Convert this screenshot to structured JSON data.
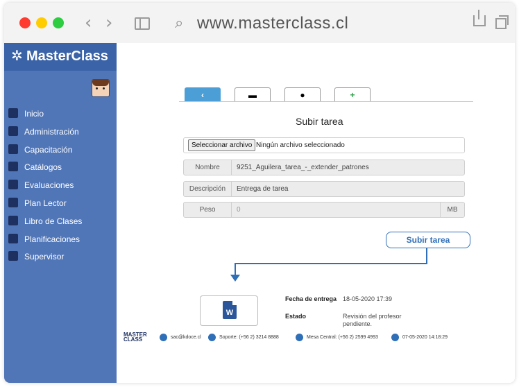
{
  "browser": {
    "url": "www.masterclass.cl",
    "dots": [
      "#ff3b30",
      "#ffcc00",
      "#2ecc40"
    ],
    "back": "‹",
    "forward": "›"
  },
  "brand": {
    "name": "MasterClass",
    "star": "✲"
  },
  "sidebar": {
    "items": [
      {
        "label": "Inicio",
        "icon": "home-icon"
      },
      {
        "label": "Administración",
        "icon": "admin-icon"
      },
      {
        "label": "Capacitación",
        "icon": "training-icon"
      },
      {
        "label": "Catálogos",
        "icon": "catalog-icon"
      },
      {
        "label": "Evaluaciones",
        "icon": "evaluation-icon"
      },
      {
        "label": "Plan Lector",
        "icon": "reading-plan-icon"
      },
      {
        "label": "Libro de Clases",
        "icon": "class-book-icon"
      },
      {
        "label": "Planificaciones",
        "icon": "planning-icon"
      },
      {
        "label": "Supervisor",
        "icon": "supervisor-icon"
      }
    ]
  },
  "tabs": [
    {
      "glyph": "‹",
      "icon": "back-icon"
    },
    {
      "glyph": "▬",
      "icon": "book-icon"
    },
    {
      "glyph": "●",
      "icon": "chat-icon"
    },
    {
      "glyph": "+",
      "icon": "file-add-icon"
    }
  ],
  "form": {
    "title": "Subir tarea",
    "file_button": "Seleccionar archivo",
    "file_status": "Ningún archivo seleccionado",
    "nombre_label": "Nombre",
    "nombre_value": "9251_Aguilera_tarea_-_extender_patrones",
    "descripcion_label": "Descripción",
    "descripcion_value": "Entrega de tarea",
    "peso_label": "Peso",
    "peso_value": "0",
    "peso_unit": "MB",
    "submit_label": "Subir tarea"
  },
  "delivery": {
    "icon_letter": "W",
    "fecha_label": "Fecha de entrega",
    "fecha_value": "18-05-2020 17:39",
    "estado_label": "Estado",
    "estado_value": "Revisión del profesor pendiente."
  },
  "footer": {
    "logo": "MASTER CLASS",
    "email": "sac@kdoce.cl",
    "soporte": "Soporte: (+56 2) 3214 8888",
    "mesa": "Mesa Central: (+56 2) 2599 4993",
    "datetime": "07-05-2020 14:18:29"
  }
}
